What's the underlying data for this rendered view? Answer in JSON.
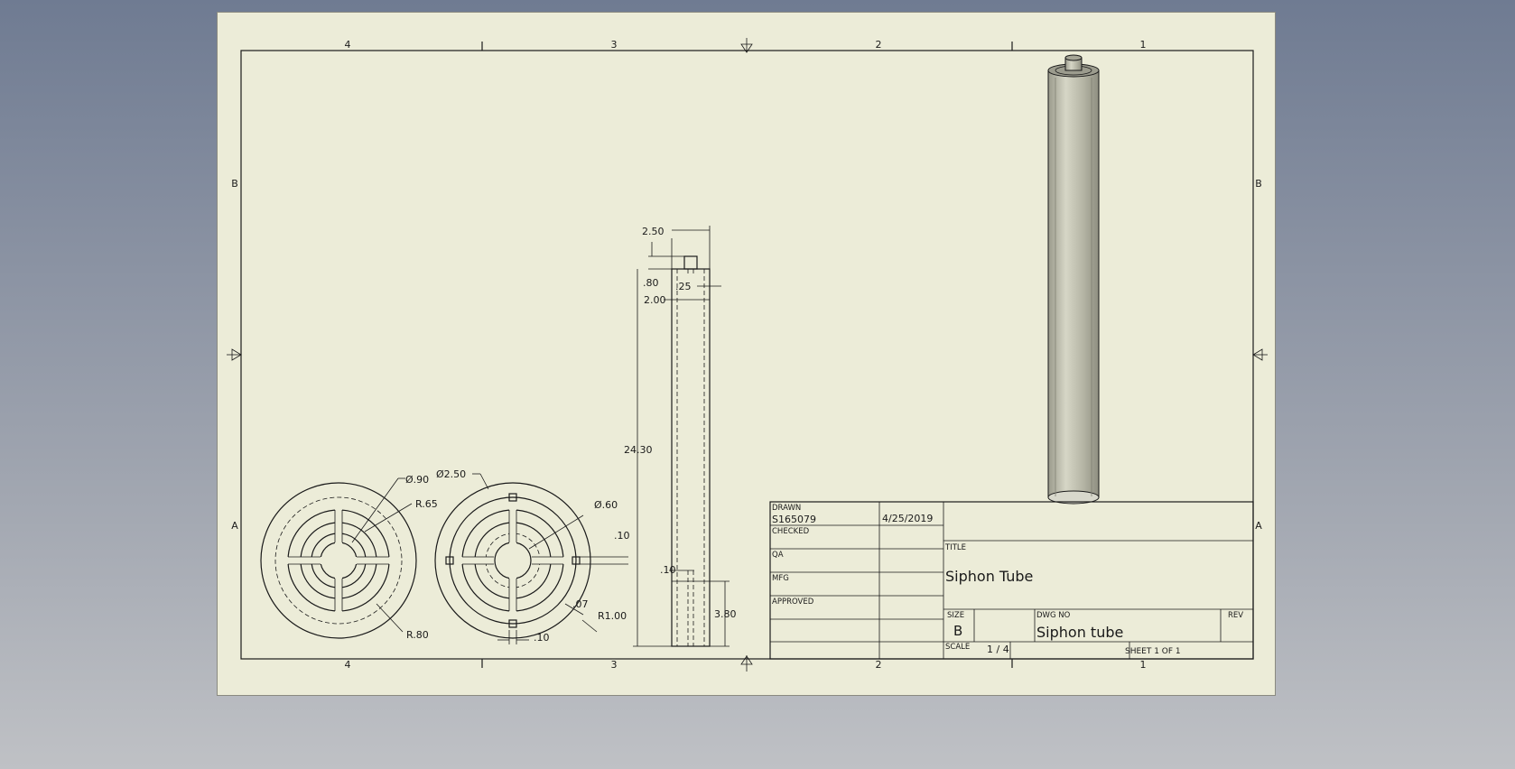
{
  "zones": {
    "columns": [
      "4",
      "3",
      "2",
      "1"
    ],
    "rows": [
      "B",
      "A"
    ]
  },
  "dimensions": {
    "front": {
      "d_top_width": "2.50",
      "d_stub_height": ".80",
      "d_stub_width": ".25",
      "d_inner_width": "2.00",
      "d_length": "24.30",
      "d_wall": ".10",
      "d_slot_height": "3.80"
    },
    "end_left": {
      "d_dia_90": "Ø.90",
      "d_r65": "R.65",
      "d_r80": "R.80"
    },
    "end_right": {
      "d_dia_250": "Ø2.50",
      "d_dia_60": "Ø.60",
      "d_10": ".10",
      "d_07": ".07",
      "d_r100": "R1.00",
      "d_bottom_10": ".10"
    }
  },
  "title_block": {
    "drawn_label": "DRAWN",
    "drawn_by": "S165079",
    "drawn_date": "4/25/2019",
    "checked_label": "CHECKED",
    "qa_label": "QA",
    "mfg_label": "MFG",
    "approved_label": "APPROVED",
    "title_label": "TITLE",
    "title": "Siphon Tube",
    "size_label": "SIZE",
    "size": "B",
    "dwg_no_label": "DWG NO",
    "dwg_no": "Siphon tube",
    "rev_label": "REV",
    "scale_label": "SCALE",
    "scale": "1 / 4",
    "sheet_label": "SHEET 1  OF 1"
  },
  "colors": {
    "paper": "#ececd8",
    "ink": "#1a1a1a",
    "shaded_body": "#b8b8a8"
  }
}
